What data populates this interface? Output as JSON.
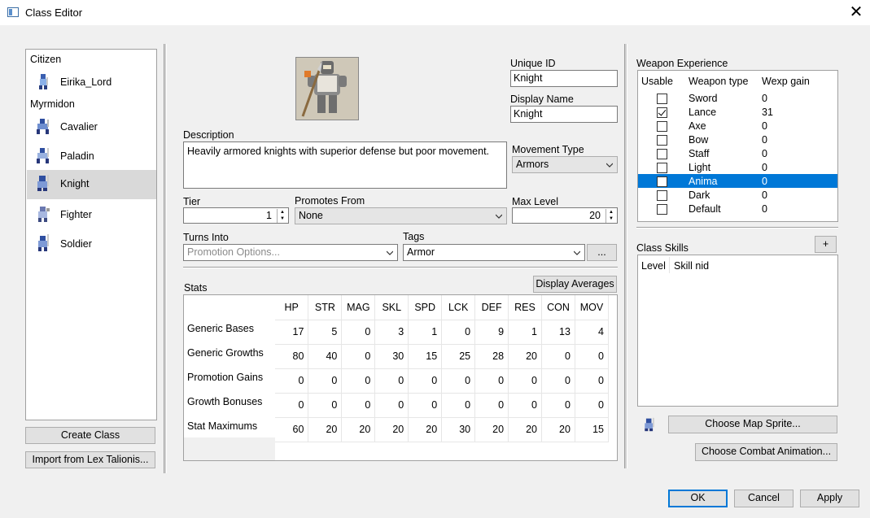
{
  "window": {
    "title": "Class Editor"
  },
  "class_list": {
    "groups": [
      {
        "name": "Citizen"
      },
      {
        "name": "Myrmidon"
      }
    ],
    "items": [
      {
        "label": "Eirika_Lord",
        "selected": false
      },
      {
        "label": "Cavalier",
        "selected": false
      },
      {
        "label": "Paladin",
        "selected": false
      },
      {
        "label": "Knight",
        "selected": true
      },
      {
        "label": "Fighter",
        "selected": false
      },
      {
        "label": "Soldier",
        "selected": false
      }
    ],
    "create_button": "Create Class",
    "import_button": "Import from Lex Talionis..."
  },
  "form": {
    "unique_id_label": "Unique ID",
    "unique_id_value": "Knight",
    "display_name_label": "Display Name",
    "display_name_value": "Knight",
    "description_label": "Description",
    "description_value": "Heavily armored knights with superior defense but poor movement.",
    "movement_type_label": "Movement Type",
    "movement_type_value": "Armors",
    "tier_label": "Tier",
    "tier_value": "1",
    "promotes_from_label": "Promotes From",
    "promotes_from_value": "None",
    "max_level_label": "Max Level",
    "max_level_value": "20",
    "turns_into_label": "Turns Into",
    "turns_into_placeholder": "Promotion Options...",
    "tags_label": "Tags",
    "tags_value": "Armor",
    "tags_more_button": "..."
  },
  "stats": {
    "label": "Stats",
    "display_averages_button": "Display Averages",
    "columns": [
      "HP",
      "STR",
      "MAG",
      "SKL",
      "SPD",
      "LCK",
      "DEF",
      "RES",
      "CON",
      "MOV"
    ],
    "rows": [
      {
        "name": "Generic Bases",
        "values": [
          "17",
          "5",
          "0",
          "3",
          "1",
          "0",
          "9",
          "1",
          "13",
          "4"
        ]
      },
      {
        "name": "Generic Growths",
        "values": [
          "80",
          "40",
          "0",
          "30",
          "15",
          "25",
          "28",
          "20",
          "0",
          "0"
        ]
      },
      {
        "name": "Promotion Gains",
        "values": [
          "0",
          "0",
          "0",
          "0",
          "0",
          "0",
          "0",
          "0",
          "0",
          "0"
        ]
      },
      {
        "name": "Growth Bonuses",
        "values": [
          "0",
          "0",
          "0",
          "0",
          "0",
          "0",
          "0",
          "0",
          "0",
          "0"
        ]
      },
      {
        "name": "Stat Maximums",
        "values": [
          "60",
          "20",
          "20",
          "20",
          "20",
          "30",
          "20",
          "20",
          "20",
          "15"
        ]
      }
    ]
  },
  "weapon_experience": {
    "label": "Weapon Experience",
    "headers": [
      "Usable",
      "Weapon type",
      "Wexp gain"
    ],
    "rows": [
      {
        "type": "Sword",
        "gain": "0",
        "usable": false,
        "selected": false
      },
      {
        "type": "Lance",
        "gain": "31",
        "usable": true,
        "selected": false
      },
      {
        "type": "Axe",
        "gain": "0",
        "usable": false,
        "selected": false
      },
      {
        "type": "Bow",
        "gain": "0",
        "usable": false,
        "selected": false
      },
      {
        "type": "Staff",
        "gain": "0",
        "usable": false,
        "selected": false
      },
      {
        "type": "Light",
        "gain": "0",
        "usable": false,
        "selected": false
      },
      {
        "type": "Anima",
        "gain": "0",
        "usable": false,
        "selected": true
      },
      {
        "type": "Dark",
        "gain": "0",
        "usable": false,
        "selected": false
      },
      {
        "type": "Default",
        "gain": "0",
        "usable": false,
        "selected": false
      }
    ]
  },
  "class_skills": {
    "label": "Class Skills",
    "add_button": "+",
    "headers": [
      "Level",
      "Skill nid"
    ]
  },
  "sprites": {
    "map_sprite_button": "Choose Map Sprite...",
    "combat_anim_button": "Choose Combat Animation..."
  },
  "dialog": {
    "ok": "OK",
    "cancel": "Cancel",
    "apply": "Apply"
  },
  "colors": {
    "selection": "#0078d7",
    "window_bg": "#f0f0f0",
    "list_selected_bg": "#d9d9d9"
  }
}
